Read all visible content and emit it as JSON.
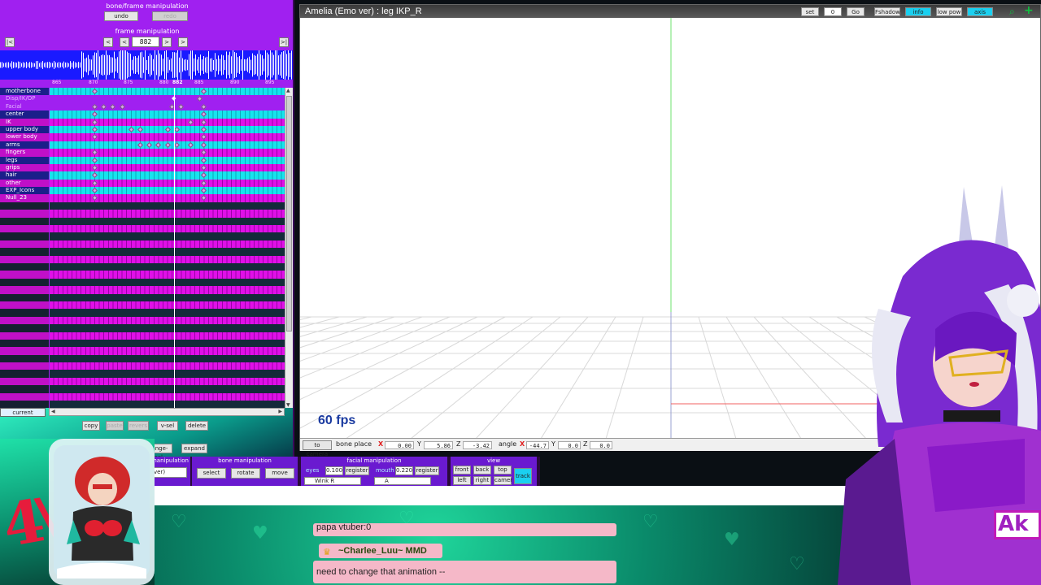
{
  "left_panel": {
    "bone_frame_title": "bone/frame manipulation",
    "undo_label": "undo",
    "redo_label": "redo",
    "frame_manip_title": "frame manipulation",
    "nav": {
      "first": "|<",
      "prev_key": "<",
      "prev": "<",
      "next": ">",
      "next_key": ">",
      "last": ">|"
    },
    "current_frame": "882",
    "ruler_ticks": [
      "865",
      "870",
      "875",
      "880",
      "882",
      "885",
      "890",
      "895"
    ],
    "tracks": [
      {
        "label": "motherbone",
        "style": "cyan"
      },
      {
        "label": "Disp/IK/OP",
        "style": "sel"
      },
      {
        "label": "Facial",
        "style": "sel"
      },
      {
        "label": "center",
        "style": "cyan"
      },
      {
        "label": "IK",
        "style": "mag"
      },
      {
        "label": "upper body",
        "style": "cyan"
      },
      {
        "label": "lower body",
        "style": "mag"
      },
      {
        "label": "arms",
        "style": "cyan"
      },
      {
        "label": "fingers",
        "style": "mag"
      },
      {
        "label": "legs",
        "style": "cyan"
      },
      {
        "label": "grips",
        "style": "mag"
      },
      {
        "label": "hair",
        "style": "cyan"
      },
      {
        "label": "other",
        "style": "mag"
      },
      {
        "label": "EXP_Icons",
        "style": "cyan"
      },
      {
        "label": "Null_23",
        "style": "mag"
      }
    ],
    "current_label": "current",
    "buttons_row1": [
      "copy",
      "paste",
      "revers",
      "v-sel",
      "delete"
    ],
    "buttons_row2": [
      "range-sel",
      "expand"
    ]
  },
  "viewport": {
    "title": "Amelia (Emo ver) : leg IKP_R",
    "toolbar": {
      "set": "set",
      "frame_value": "0",
      "go": "Go",
      "fshadow": "Fshadow",
      "info": "info",
      "low_pow": "low pow",
      "axis": "axis"
    },
    "fps": "60 fps",
    "status": {
      "to_camera": "to camera",
      "bone_place": "bone place",
      "x_label": "X",
      "x_val": "0.00",
      "y_label": "Y",
      "y_val": "5.86",
      "z_label": "Z",
      "z_val": "-3.42",
      "angle": "angle",
      "ax_val": "-44.7",
      "ay_val": "0.0",
      "az_val": "0.0"
    }
  },
  "manip": {
    "left_panel_title": "manipulation",
    "left_select": "ver)",
    "bone_title": "bone manipulation",
    "bone_buttons": [
      "select",
      "rotate",
      "move"
    ],
    "facial_title": "facial manipulation",
    "eyes_label": "eyes",
    "eyes_val": "0.100",
    "mouth_label": "mouth",
    "mouth_val": "0.220",
    "register": "register",
    "eyes_select": "Wink R",
    "mouth_select": "A",
    "view_title": "view",
    "view_buttons": [
      "front",
      "back",
      "top",
      "left",
      "right",
      "camer"
    ],
    "track": "track"
  },
  "chat": {
    "msg1": "papa vtuber:0",
    "author": "~Charlee_Luu~ MMD",
    "msg2": "need to change that animation --"
  },
  "avatar_tag": "Ak",
  "colors": {
    "panel_purple": "#a020f0",
    "track_cyan": "#16e4ee",
    "track_magenta": "#e010e8",
    "fps_blue": "#1a3aa0",
    "chat_pink": "#f5b8c8"
  }
}
